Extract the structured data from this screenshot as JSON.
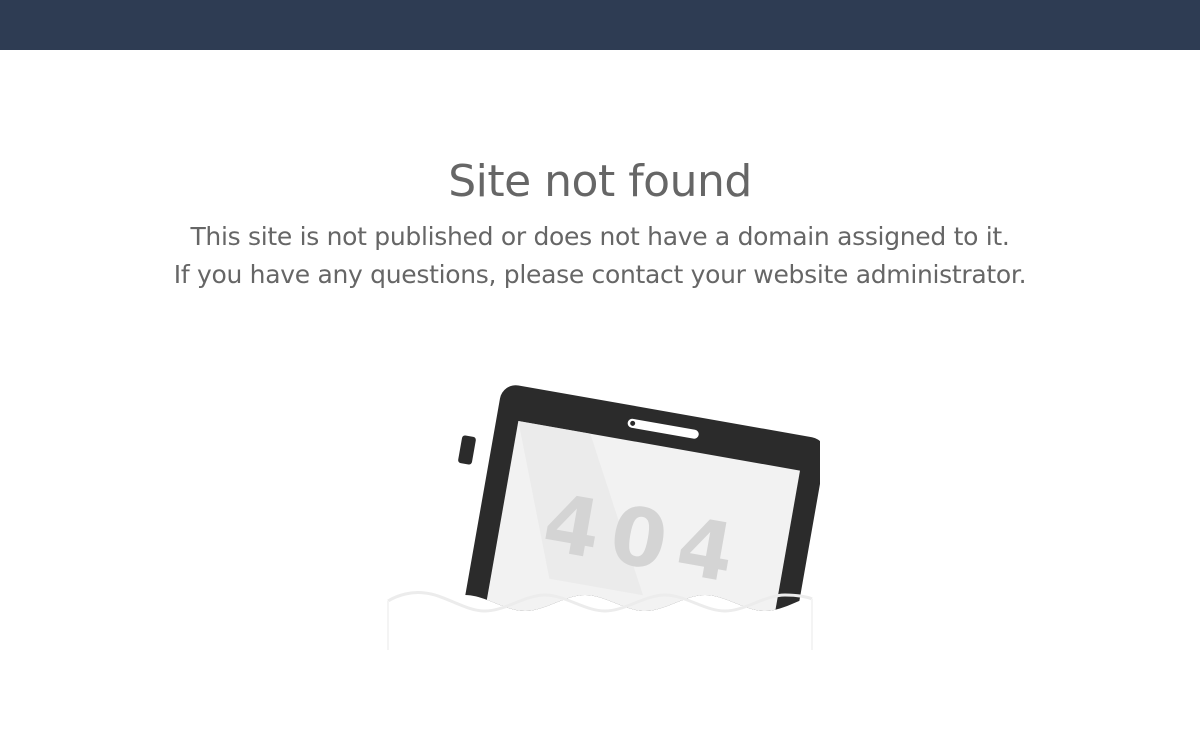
{
  "error": {
    "title": "Site not found",
    "message_line1": "This site is not published or does not have a domain assigned to it.",
    "message_line2": "If you have any questions, please contact your website administrator.",
    "code": "404"
  },
  "colors": {
    "topbar": "#2e3c53",
    "text": "#666666",
    "device": "#2b2b2b",
    "screen": "#f2f2f2",
    "code_text": "#d4d4d4"
  },
  "illustration": {
    "icon": "tablet-404-icon"
  }
}
